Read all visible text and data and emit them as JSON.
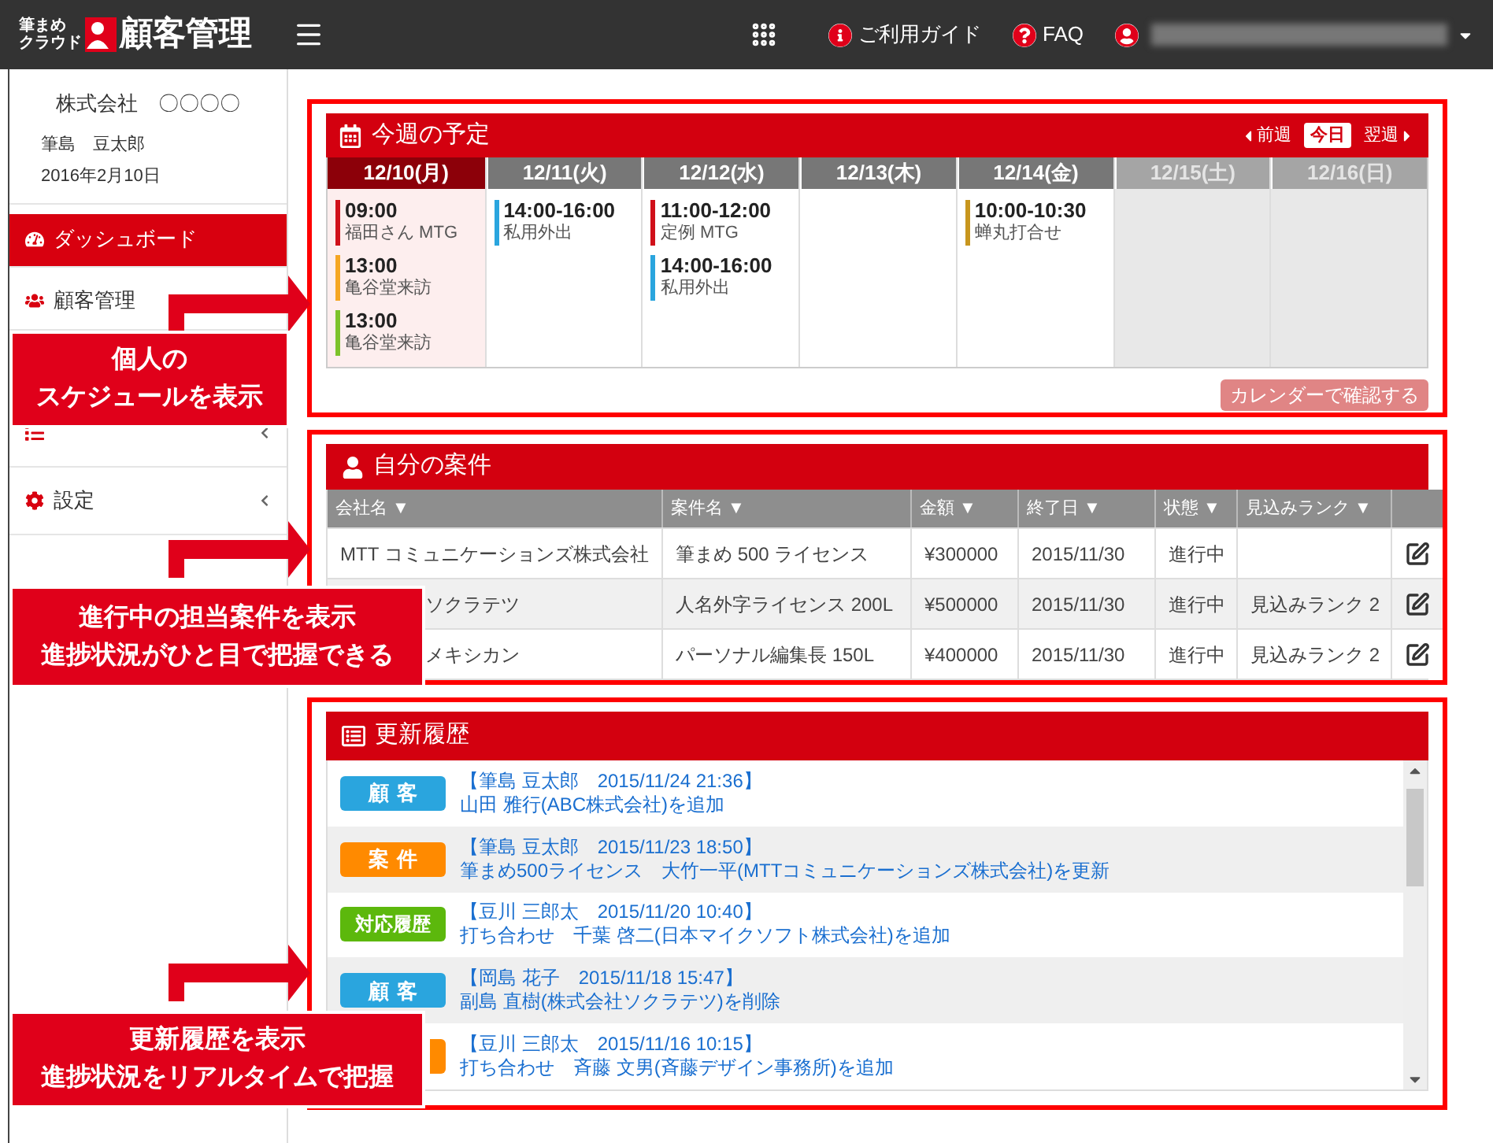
{
  "header": {
    "logo_small": [
      "筆まめ",
      "クラウド"
    ],
    "logo_title": "顧客管理",
    "links": [
      {
        "kind": "info",
        "label": "ご利用ガイド"
      },
      {
        "kind": "help",
        "label": "FAQ"
      }
    ]
  },
  "sidebar": {
    "company": "株式会社　〇〇〇〇",
    "user": "筆島　豆太郎",
    "date": "2016年2月10日",
    "items": [
      {
        "kind": "dashboard",
        "label": "ダッシュボード",
        "selected": true,
        "expandable": false
      },
      {
        "kind": "customers",
        "label": "顧客管理",
        "selected": false,
        "expandable": false
      },
      {
        "kind": "history",
        "selected": false,
        "expandable": true
      },
      {
        "kind": "settings",
        "label": "設定",
        "selected": false,
        "expandable": true
      }
    ]
  },
  "schedule": {
    "title": "今週の予定",
    "nav": {
      "prev": "前週",
      "today": "今日",
      "next": "翌週"
    },
    "days": [
      {
        "label": "12/10(月)",
        "kind": "weekday",
        "selected": true,
        "events": [
          {
            "time": "09:00",
            "title": "福田さん MTG",
            "color": "#d0101a"
          },
          {
            "time": "13:00",
            "title": "亀谷堂来訪",
            "color": "#f5a623"
          },
          {
            "time": "13:00",
            "title": "亀谷堂来訪",
            "color": "#7dc22a"
          }
        ]
      },
      {
        "label": "12/11(火)",
        "kind": "weekday",
        "selected": false,
        "events": [
          {
            "time": "14:00-16:00",
            "title": "私用外出",
            "color": "#2aa5de"
          }
        ]
      },
      {
        "label": "12/12(水)",
        "kind": "weekday",
        "selected": false,
        "events": [
          {
            "time": "11:00-12:00",
            "title": "定例 MTG",
            "color": "#d0101a"
          },
          {
            "time": "14:00-16:00",
            "title": "私用外出",
            "color": "#2aa5de"
          }
        ]
      },
      {
        "label": "12/13(木)",
        "kind": "weekday",
        "selected": false
      },
      {
        "label": "12/14(金)",
        "kind": "weekday",
        "selected": false,
        "events": [
          {
            "time": "10:00-10:30",
            "title": "蝉丸打合せ",
            "color": "#c8961e"
          }
        ]
      },
      {
        "label": "12/15(土)",
        "kind": "weekend",
        "selected": false
      },
      {
        "label": "12/16(日)",
        "kind": "weekend",
        "selected": false
      }
    ],
    "button": "カレンダーで確認する"
  },
  "cases": {
    "title": "自分の案件",
    "columns": [
      "会社名 ▼",
      "案件名 ▼",
      "金額 ▼",
      "終了日 ▼",
      "状態 ▼",
      "見込みランク ▼"
    ],
    "rows": [
      {
        "kind": "full",
        "company": "MTT コミュニケーションズ株式会社",
        "name": "筆まめ 500 ライセンス",
        "amount": "¥300000",
        "end": "2015/11/30",
        "status": "進行中"
      },
      {
        "kind": "partly_hidden",
        "company": "ソクラテツ",
        "name": "人名外字ライセンス 200L",
        "amount": "¥500000",
        "end": "2015/11/30",
        "status": "進行中",
        "rank": "見込みランク 2"
      },
      {
        "kind": "partly_hidden",
        "company": "メキシカン",
        "name": "パーソナル編集長  150L",
        "amount": "¥400000",
        "end": "2015/11/30",
        "status": "進行中",
        "rank": "見込みランク 2"
      }
    ]
  },
  "history": {
    "title": "更新履歴",
    "items": [
      {
        "tag": "顧客",
        "color": "#2aa5de",
        "heading": "【筆島 豆太郎　2015/11/24 21:36】",
        "text": "山田 雅行(ABC株式会社)を追加"
      },
      {
        "tag": "案件",
        "color": "#ff8a00",
        "heading": "【筆島 豆太郎　2015/11/23 18:50】",
        "text": "筆まめ500ライセンス　大竹一平(MTTコミュニケーションズ株式会社)を更新"
      },
      {
        "tag": "対応履歴",
        "color": "#5cb80c",
        "heading": "【豆川 三郎太　2015/11/20 10:40】",
        "text": "打ち合わせ　千葉 啓二(日本マイクソフト株式会社)を追加"
      },
      {
        "tag": "顧客",
        "color": "#2aa5de",
        "heading": "【岡島 花子　2015/11/18 15:47】",
        "text": "副島 直樹(株式会社ソクラテツ)を削除"
      },
      {
        "kind": "partly_hidden",
        "color": "#ff8a00",
        "heading": "【豆川 三郎太　2015/11/16 10:15】",
        "text": "打ち合わせ　斉藤 文男(斉藤デザイン事務所)を追加"
      }
    ]
  },
  "callouts": [
    {
      "lines": [
        "個人の",
        "スケジュールを表示"
      ]
    },
    {
      "lines": [
        "進行中の担当案件を表示",
        "進捗状況がひと目で把握できる"
      ]
    },
    {
      "lines": [
        "更新履歴を表示",
        "進捗状況をリアルタイムで把握"
      ]
    }
  ]
}
